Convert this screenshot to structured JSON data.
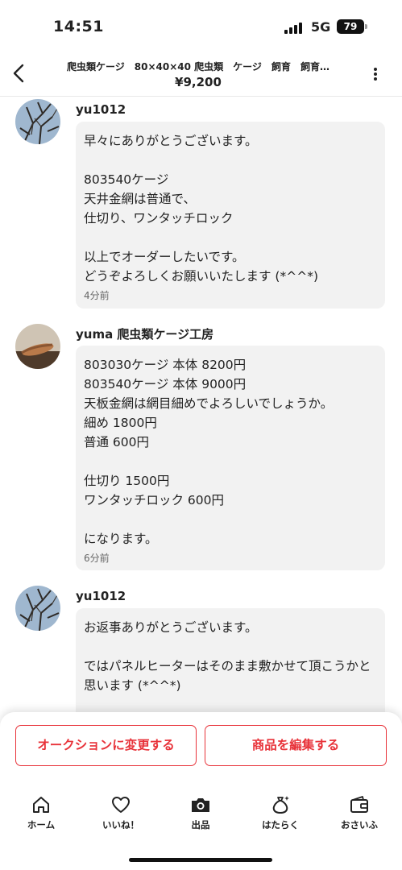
{
  "status_bar": {
    "time": "14:51",
    "network": "5G",
    "battery": "79"
  },
  "header": {
    "title": "爬虫類ケージ　80×40×40 爬虫類　ケージ　飼育　飼育…",
    "price": "¥9,200",
    "icons": {
      "back": "chevron-left-icon",
      "more": "more-vertical-icon"
    }
  },
  "messages": [
    {
      "sender": "yu1012",
      "text": "早々にありがとうございます。\n\n803540ケージ\n天井金網は普通で、\n仕切り、ワンタッチロック\n\n以上でオーダーしたいです。\nどうぞよろしくお願いいたします (*^^*)",
      "time": "4分前"
    },
    {
      "sender": "yuma 爬虫類ケージ工房",
      "text": "803030ケージ 本体 8200円\n803540ケージ 本体 9000円\n天板金網は網目細めでよろしいでしょうか。\n細め 1800円\n普通 600円\n\n仕切り 1500円\nワンタッチロック 600円\n\nになります。",
      "time": "6分前"
    },
    {
      "sender": "yu1012",
      "text": "お返事ありがとうございます。\n\nではパネルヒーターはそのまま敷かせて頂こうかと思います (*^^*)",
      "time": ""
    }
  ],
  "actions": {
    "auction_label": "オークションに変更する",
    "edit_label": "商品を編集する",
    "accent_color": "#e8333a"
  },
  "tabs": [
    {
      "label": "ホーム",
      "icon": "home-icon"
    },
    {
      "label": "いいね！",
      "icon": "heart-icon"
    },
    {
      "label": "出品",
      "icon": "camera-icon"
    },
    {
      "label": "はたらく",
      "icon": "money-bag-icon"
    },
    {
      "label": "おさいふ",
      "icon": "wallet-icon"
    }
  ]
}
